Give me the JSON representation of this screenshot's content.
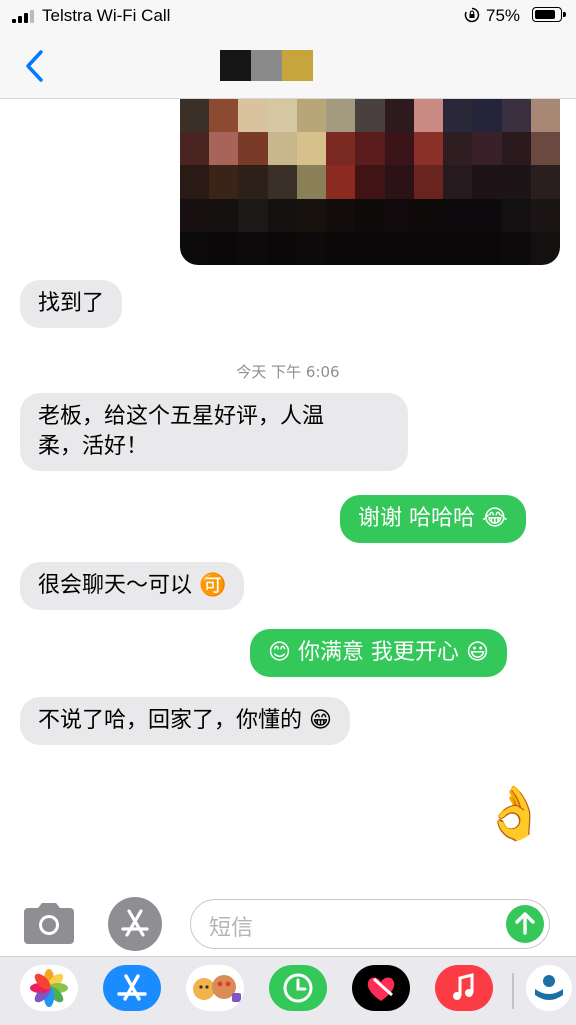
{
  "status_bar": {
    "carrier": "Telstra Wi-Fi Call",
    "battery_percent": "75%",
    "battery_level": 0.75
  },
  "nav": {
    "back_icon": "chevron-left-icon",
    "contact_avatar_colors": [
      "#161616",
      "#8a8a8a",
      "#c6a53d"
    ]
  },
  "messages": {
    "found": "找到了",
    "timestamp": "今天 下午 6:06",
    "review": "老板，给这个五星好评，人温柔，活好！",
    "review_line1": "老板，给这个五星好评，人温",
    "review_line2": "柔，活好！",
    "thanks": "谢谢 哈哈哈",
    "thanks_emoji": "😂",
    "chat": "很会聊天～可以",
    "chat_emoji": "🉑",
    "happy_emoji_left": "😊",
    "happy": "你满意 我更开心",
    "happy_emoji_right": "😃",
    "bye": "不说了哈，回家了，你懂的",
    "bye_emoji": "😁",
    "ok_emoji": "👌"
  },
  "input": {
    "placeholder": "短信",
    "camera_icon": "camera-icon",
    "appstore_icon": "app-store-icon",
    "send_icon": "arrow-up-icon"
  },
  "app_drawer": {
    "apps": [
      "photos-icon",
      "app-store-icon",
      "memoji-icon",
      "screen-time-icon",
      "digital-touch-icon",
      "music-icon",
      "app-icon"
    ]
  },
  "colors": {
    "sent_bubble": "#34c759",
    "received_bubble": "#e9e9eb",
    "ios_blue": "#007aff"
  }
}
